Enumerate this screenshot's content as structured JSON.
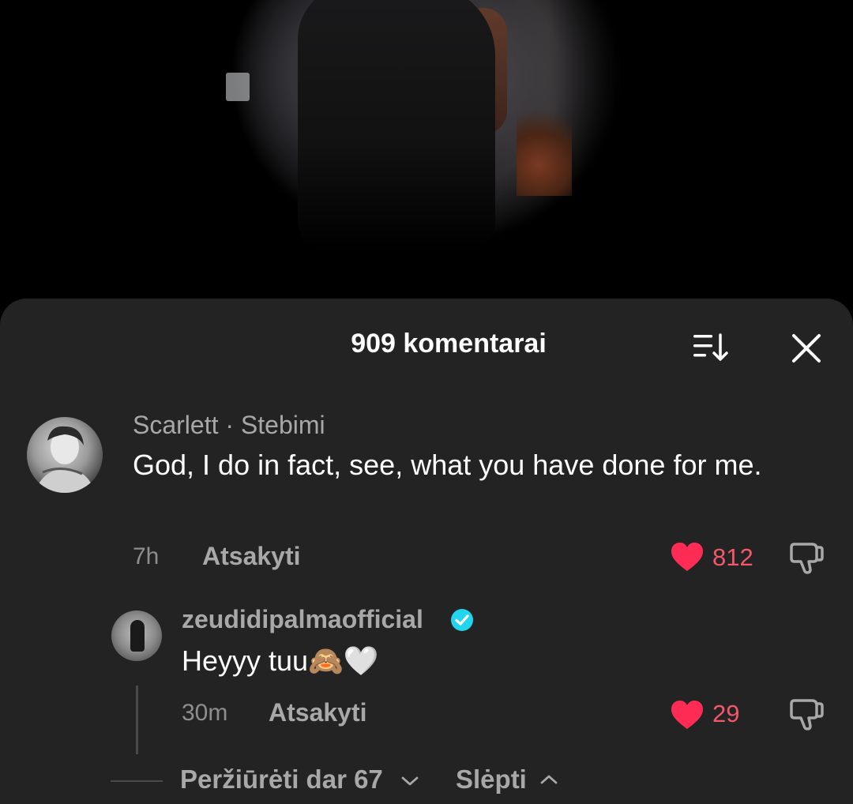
{
  "header": {
    "title": "909 komentarai"
  },
  "comments": [
    {
      "username": "Scarlett",
      "tag": "· Stebimi",
      "text": "God, I do in fact, see, what you have done for me.",
      "time": "7h",
      "reply_label": "Atsakyti",
      "likes": "812"
    }
  ],
  "replies": [
    {
      "username": "zeudidipalmaofficial",
      "text": "Heyyy tuu🙈🤍",
      "time": "30m",
      "reply_label": "Atsakyti",
      "likes": "29",
      "verified": true
    }
  ],
  "thread": {
    "view_more_label": "Peržiūrėti dar 67",
    "hide_label": "Slėpti"
  },
  "colors": {
    "sheet_bg": "#232323",
    "like_red": "#f3576b",
    "verified_blue": "#20d5ec"
  },
  "icons": [
    "sort-icon",
    "close-icon",
    "heart-icon",
    "dislike-icon",
    "verified-icon",
    "chevron-down-icon",
    "chevron-up-icon"
  ]
}
